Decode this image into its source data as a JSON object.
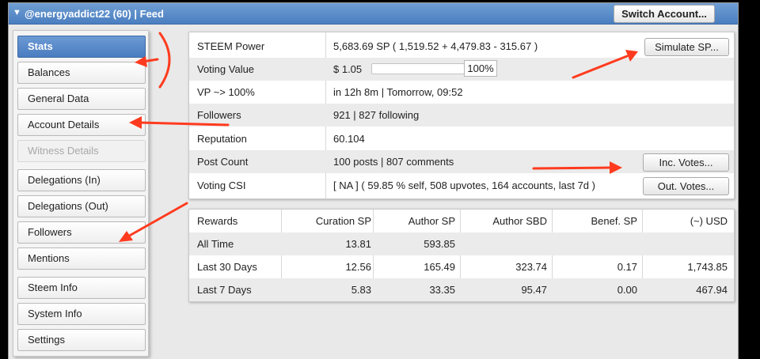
{
  "titlebar": {
    "title": "@energyaddict22 (60)  |  Feed",
    "collapse_icon": "triangle-down-icon",
    "switch_label": "Switch Account..."
  },
  "sidebar": {
    "items": [
      {
        "label": "Stats",
        "state": "active"
      },
      {
        "label": "Balances",
        "state": "normal"
      },
      {
        "label": "General Data",
        "state": "normal"
      },
      {
        "label": "Account Details",
        "state": "normal"
      },
      {
        "label": "Witness Details",
        "state": "disabled"
      },
      {
        "label": "Delegations (In)",
        "state": "normal"
      },
      {
        "label": "Delegations (Out)",
        "state": "normal"
      },
      {
        "label": "Followers",
        "state": "normal"
      },
      {
        "label": "Mentions",
        "state": "normal"
      },
      {
        "label": "Steem Info",
        "state": "normal"
      },
      {
        "label": "System Info",
        "state": "normal"
      },
      {
        "label": "Settings",
        "state": "normal"
      }
    ]
  },
  "stats": {
    "rows": [
      {
        "label": "STEEM Power",
        "value": "5,683.69 SP ( 1,519.52 + 4,479.83 - 315.67 )"
      },
      {
        "label": "Voting Value",
        "value": "$ 1.05"
      },
      {
        "label": "VP ~> 100%",
        "value": "in 12h 8m | Tomorrow, 09:52"
      },
      {
        "label": "Followers",
        "value": "921 | 827 following"
      },
      {
        "label": "Reputation",
        "value": "60.104"
      },
      {
        "label": "Post Count",
        "value": "100 posts | 807 comments"
      },
      {
        "label": "Voting CSI",
        "value": "[ NA ] ( 59.85 % self, 508 upvotes, 164 accounts, last 7d )"
      }
    ],
    "voting_percent": "100%",
    "voting_bar_fill": 0,
    "simulate_label": "Simulate SP...",
    "inc_votes_label": "Inc. Votes...",
    "out_votes_label": "Out. Votes..."
  },
  "rewards": {
    "headers": [
      "Rewards",
      "Curation SP",
      "Author SP",
      "Author SBD",
      "Benef. SP",
      "(~) USD"
    ],
    "rows": [
      [
        "All Time",
        "13.81",
        "593.85",
        "",
        "",
        ""
      ],
      [
        "Last 30 Days",
        "12.56",
        "165.49",
        "323.74",
        "0.17",
        "1,743.85"
      ],
      [
        "Last 7 Days",
        "5.83",
        "33.35",
        "95.47",
        "0.00",
        "467.94"
      ]
    ]
  },
  "colors": {
    "accent": "#4a7ec0",
    "arrow": "#ff3b1f"
  }
}
